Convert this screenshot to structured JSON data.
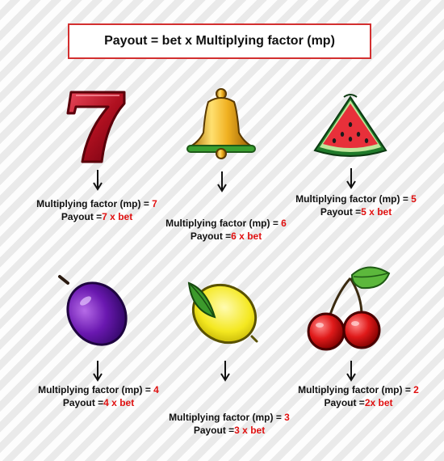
{
  "formula": "Payout = bet x Multiplying factor (mp)",
  "items": [
    {
      "symbol": "seven-icon",
      "mp_label": "Multiplying factor (mp) = ",
      "mp": "7",
      "payout_label": "Payout =",
      "payout": "7 x bet"
    },
    {
      "symbol": "bell-icon",
      "mp_label": "Multiplying factor (mp) = ",
      "mp": "6",
      "payout_label": "Payout =",
      "payout": "6 x bet"
    },
    {
      "symbol": "watermelon-icon",
      "mp_label": "Multiplying factor (mp) = ",
      "mp": "5",
      "payout_label": "Payout =",
      "payout": "5 x bet"
    },
    {
      "symbol": "plum-icon",
      "mp_label": "Multiplying factor (mp) = ",
      "mp": "4",
      "payout_label": "Payout =",
      "payout": "4 x bet"
    },
    {
      "symbol": "lemon-icon",
      "mp_label": "Multiplying factor (mp) = ",
      "mp": "3",
      "payout_label": "Payout =",
      "payout": "3 x bet"
    },
    {
      "symbol": "cherry-icon",
      "mp_label": "Multiplying factor (mp) = ",
      "mp": "2",
      "payout_label": "Payout =",
      "payout": "2x bet"
    }
  ],
  "colors": {
    "accent": "#e01010",
    "border": "#d32f2f"
  }
}
